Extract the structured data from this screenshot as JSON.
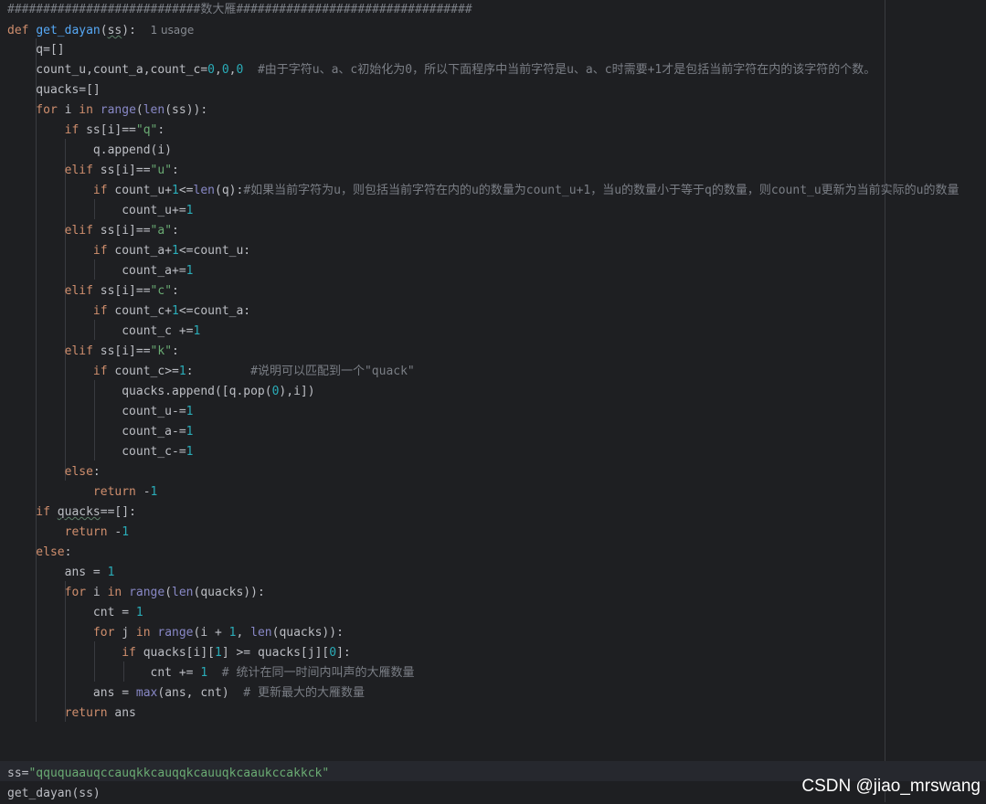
{
  "editor": {
    "lines": [
      {
        "t": "header",
        "parts": [
          {
            "c": "cmt",
            "v": "###########################数大雁#################################"
          }
        ]
      },
      {
        "parts": [
          {
            "c": "kw",
            "v": "def "
          },
          {
            "c": "fn",
            "v": "get_dayan"
          },
          {
            "c": "plain",
            "v": "("
          },
          {
            "c": "plain squig",
            "v": "ss"
          },
          {
            "c": "plain",
            "v": "):  "
          },
          {
            "c": "usage",
            "v": "1 usage"
          }
        ]
      },
      {
        "parts": [
          {
            "c": "plain",
            "v": "    q=[]"
          }
        ]
      },
      {
        "parts": [
          {
            "c": "plain",
            "v": "    count_u,count_a,count_c="
          },
          {
            "c": "num",
            "v": "0"
          },
          {
            "c": "plain",
            "v": ","
          },
          {
            "c": "num",
            "v": "0"
          },
          {
            "c": "plain",
            "v": ","
          },
          {
            "c": "num",
            "v": "0"
          },
          {
            "c": "cmt",
            "v": "  #由于字符u、a、c初始化为0，所以下面程序中当前字符是u、a、c时需要+1才是包括当前字符在内的该字符的个数。"
          }
        ]
      },
      {
        "parts": [
          {
            "c": "plain",
            "v": "    quacks=[]"
          }
        ]
      },
      {
        "parts": [
          {
            "c": "kw",
            "v": "    for "
          },
          {
            "c": "plain",
            "v": "i "
          },
          {
            "c": "kw",
            "v": "in "
          },
          {
            "c": "bi",
            "v": "range"
          },
          {
            "c": "plain",
            "v": "("
          },
          {
            "c": "bi",
            "v": "len"
          },
          {
            "c": "plain",
            "v": "(ss)):"
          }
        ]
      },
      {
        "parts": [
          {
            "c": "kw",
            "v": "        if "
          },
          {
            "c": "plain",
            "v": "ss[i]=="
          },
          {
            "c": "str",
            "v": "\"q\""
          },
          {
            "c": "plain",
            "v": ":"
          }
        ]
      },
      {
        "parts": [
          {
            "c": "plain",
            "v": "            q.append(i)"
          }
        ]
      },
      {
        "parts": [
          {
            "c": "kw",
            "v": "        elif "
          },
          {
            "c": "plain",
            "v": "ss[i]=="
          },
          {
            "c": "str",
            "v": "\"u\""
          },
          {
            "c": "plain",
            "v": ":"
          }
        ]
      },
      {
        "parts": [
          {
            "c": "kw",
            "v": "            if "
          },
          {
            "c": "plain",
            "v": "count_u+"
          },
          {
            "c": "num",
            "v": "1"
          },
          {
            "c": "plain",
            "v": "<="
          },
          {
            "c": "bi",
            "v": "len"
          },
          {
            "c": "plain",
            "v": "(q):"
          },
          {
            "c": "cmt",
            "v": "#如果当前字符为u，则包括当前字符在内的u的数量为count_u+1，当u的数量小于等于q的数量，则count_u更新为当前实际的u的数量"
          }
        ]
      },
      {
        "parts": [
          {
            "c": "plain",
            "v": "                count_u+="
          },
          {
            "c": "num",
            "v": "1"
          }
        ]
      },
      {
        "parts": [
          {
            "c": "kw",
            "v": "        elif "
          },
          {
            "c": "plain",
            "v": "ss[i]=="
          },
          {
            "c": "str",
            "v": "\"a\""
          },
          {
            "c": "plain",
            "v": ":"
          }
        ]
      },
      {
        "parts": [
          {
            "c": "kw",
            "v": "            if "
          },
          {
            "c": "plain",
            "v": "count_a+"
          },
          {
            "c": "num",
            "v": "1"
          },
          {
            "c": "plain",
            "v": "<=count_u:"
          }
        ]
      },
      {
        "parts": [
          {
            "c": "plain",
            "v": "                count_a+="
          },
          {
            "c": "num",
            "v": "1"
          }
        ]
      },
      {
        "parts": [
          {
            "c": "kw",
            "v": "        elif "
          },
          {
            "c": "plain",
            "v": "ss[i]=="
          },
          {
            "c": "str",
            "v": "\"c\""
          },
          {
            "c": "plain",
            "v": ":"
          }
        ]
      },
      {
        "parts": [
          {
            "c": "kw",
            "v": "            if "
          },
          {
            "c": "plain",
            "v": "count_c+"
          },
          {
            "c": "num",
            "v": "1"
          },
          {
            "c": "plain",
            "v": "<=count_a:"
          }
        ]
      },
      {
        "parts": [
          {
            "c": "plain",
            "v": "                count_c +="
          },
          {
            "c": "num",
            "v": "1"
          }
        ]
      },
      {
        "parts": [
          {
            "c": "kw",
            "v": "        elif "
          },
          {
            "c": "plain",
            "v": "ss[i]=="
          },
          {
            "c": "str",
            "v": "\"k\""
          },
          {
            "c": "plain",
            "v": ":"
          }
        ]
      },
      {
        "parts": [
          {
            "c": "kw",
            "v": "            if "
          },
          {
            "c": "plain",
            "v": "count_c>="
          },
          {
            "c": "num",
            "v": "1"
          },
          {
            "c": "plain",
            "v": ":        "
          },
          {
            "c": "cmt",
            "v": "#说明可以匹配到一个\"quack\""
          }
        ]
      },
      {
        "parts": [
          {
            "c": "plain",
            "v": "                quacks.append([q.pop("
          },
          {
            "c": "num",
            "v": "0"
          },
          {
            "c": "plain",
            "v": "),i])"
          }
        ]
      },
      {
        "parts": [
          {
            "c": "plain",
            "v": "                count_u-="
          },
          {
            "c": "num",
            "v": "1"
          }
        ]
      },
      {
        "parts": [
          {
            "c": "plain",
            "v": "                count_a-="
          },
          {
            "c": "num",
            "v": "1"
          }
        ]
      },
      {
        "parts": [
          {
            "c": "plain",
            "v": "                count_c-="
          },
          {
            "c": "num",
            "v": "1"
          }
        ]
      },
      {
        "parts": [
          {
            "c": "kw",
            "v": "        else"
          },
          {
            "c": "plain",
            "v": ":"
          }
        ]
      },
      {
        "parts": [
          {
            "c": "kw",
            "v": "            return "
          },
          {
            "c": "plain",
            "v": "-"
          },
          {
            "c": "num",
            "v": "1"
          }
        ]
      },
      {
        "parts": [
          {
            "c": "kw",
            "v": "    if "
          },
          {
            "c": "plain squig",
            "v": "quacks"
          },
          {
            "c": "plain",
            "v": "==[]:"
          }
        ]
      },
      {
        "parts": [
          {
            "c": "kw",
            "v": "        return "
          },
          {
            "c": "plain",
            "v": "-"
          },
          {
            "c": "num",
            "v": "1"
          }
        ]
      },
      {
        "parts": [
          {
            "c": "kw",
            "v": "    else"
          },
          {
            "c": "plain",
            "v": ":"
          }
        ]
      },
      {
        "parts": [
          {
            "c": "plain",
            "v": "        ans = "
          },
          {
            "c": "num",
            "v": "1"
          }
        ]
      },
      {
        "parts": [
          {
            "c": "kw",
            "v": "        for "
          },
          {
            "c": "plain",
            "v": "i "
          },
          {
            "c": "kw",
            "v": "in "
          },
          {
            "c": "bi",
            "v": "range"
          },
          {
            "c": "plain",
            "v": "("
          },
          {
            "c": "bi",
            "v": "len"
          },
          {
            "c": "plain",
            "v": "(quacks)):"
          }
        ]
      },
      {
        "parts": [
          {
            "c": "plain",
            "v": "            cnt = "
          },
          {
            "c": "num",
            "v": "1"
          }
        ]
      },
      {
        "parts": [
          {
            "c": "kw",
            "v": "            for "
          },
          {
            "c": "plain",
            "v": "j "
          },
          {
            "c": "kw",
            "v": "in "
          },
          {
            "c": "bi",
            "v": "range"
          },
          {
            "c": "plain",
            "v": "(i + "
          },
          {
            "c": "num",
            "v": "1"
          },
          {
            "c": "plain",
            "v": ", "
          },
          {
            "c": "bi",
            "v": "len"
          },
          {
            "c": "plain",
            "v": "(quacks)):"
          }
        ]
      },
      {
        "parts": [
          {
            "c": "kw",
            "v": "                if "
          },
          {
            "c": "plain",
            "v": "quacks[i]["
          },
          {
            "c": "num",
            "v": "1"
          },
          {
            "c": "plain",
            "v": "] >= quacks[j]["
          },
          {
            "c": "num",
            "v": "0"
          },
          {
            "c": "plain",
            "v": "]:"
          }
        ]
      },
      {
        "parts": [
          {
            "c": "plain",
            "v": "                    cnt += "
          },
          {
            "c": "num",
            "v": "1"
          },
          {
            "c": "cmt",
            "v": "  # 统计在同一时间内叫声的大雁数量"
          }
        ]
      },
      {
        "parts": [
          {
            "c": "plain",
            "v": "            ans = "
          },
          {
            "c": "bi",
            "v": "max"
          },
          {
            "c": "plain",
            "v": "(ans, cnt)"
          },
          {
            "c": "cmt",
            "v": "  # 更新最大的大雁数量"
          }
        ]
      },
      {
        "parts": [
          {
            "c": "kw",
            "v": "        return "
          },
          {
            "c": "plain",
            "v": "ans"
          }
        ]
      },
      {
        "parts": []
      },
      {
        "parts": []
      },
      {
        "parts": [
          {
            "c": "plain",
            "v": "ss="
          },
          {
            "c": "str",
            "v": "\"qququaauqccauqkkcauqqkcauuqkcaaukccakkck\""
          }
        ]
      },
      {
        "parts": [
          {
            "c": "plain",
            "v": "get_dayan(ss)"
          }
        ]
      }
    ]
  },
  "watermark": "CSDN @jiao_mrswang",
  "colors": {
    "background": "#1e1f22",
    "keyword": "#cf8e6d",
    "function": "#56a8f5",
    "number": "#2aacb8",
    "string": "#6aab73",
    "comment": "#7a7e85",
    "builtin": "#8888c6"
  }
}
